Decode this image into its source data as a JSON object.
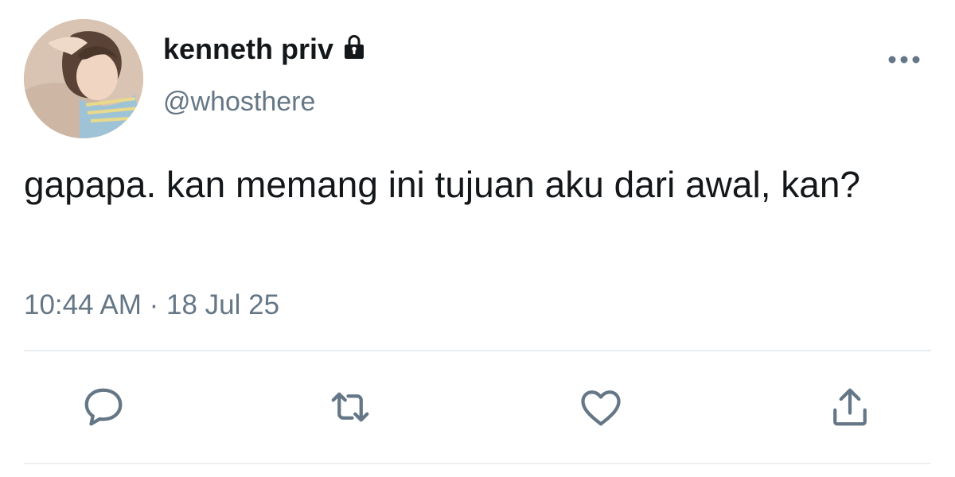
{
  "user": {
    "display_name": "kenneth priv",
    "handle": "@whosthere",
    "protected_icon": "lock-icon",
    "avatar_icon": "profile-photo"
  },
  "tweet": {
    "text": "gapapa. kan memang ini tujuan aku dari awal, kan?",
    "time": "10:44 AM",
    "separator": "·",
    "date": "18 Jul 25"
  },
  "actions": [
    {
      "name": "reply",
      "icon": "speech-bubble-icon"
    },
    {
      "name": "retweet",
      "icon": "retweet-icon"
    },
    {
      "name": "like",
      "icon": "heart-icon"
    },
    {
      "name": "share",
      "icon": "share-icon"
    }
  ],
  "colors": {
    "text": "#14171a",
    "secondary": "#657786",
    "divider": "#e6ecf0"
  }
}
